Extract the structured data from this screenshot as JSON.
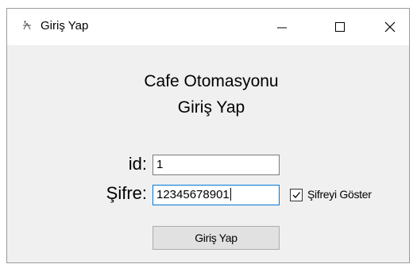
{
  "window": {
    "title": "Giriş Yap"
  },
  "header": {
    "app_name": "Cafe Otomasyonu",
    "subtitle": "Giriş Yap"
  },
  "form": {
    "id_label": "id:",
    "id_value": "1",
    "password_label": "Şifre:",
    "password_value": "12345678901",
    "show_password_label": "Şifreyi Göster",
    "show_password_checked": true,
    "submit_label": "Giriş Yap"
  },
  "colors": {
    "window_bg": "#f0f0f0",
    "focus_border": "#0078d7",
    "button_bg": "#e1e1e1"
  },
  "icons": {
    "app": "app-icon",
    "minimize": "minimize-icon",
    "maximize": "maximize-icon",
    "close": "close-icon",
    "check": "checkmark-icon"
  }
}
